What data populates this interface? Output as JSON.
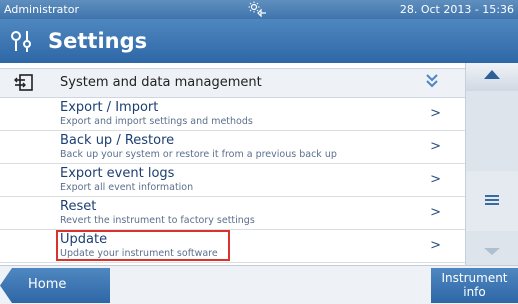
{
  "status": {
    "user": "Administrator",
    "datetime": "28. Oct 2013 - 15:36",
    "mode_icon": "sun-wave-icon"
  },
  "header": {
    "title": "Settings",
    "icon": "settings-sliders-icon"
  },
  "section": {
    "label": "System and data management",
    "icon": "system-data-icon",
    "collapse_icon": "double-chevron-down-icon"
  },
  "items": [
    {
      "name": "Export / Import",
      "desc": "Export and import settings and methods",
      "arrow": ">"
    },
    {
      "name": "Back up / Restore",
      "desc": "Back up your system or restore it from a previous back up",
      "arrow": ">"
    },
    {
      "name": "Export event logs",
      "desc": "Export all event information",
      "arrow": ">"
    },
    {
      "name": "Reset",
      "desc": "Revert the instrument to factory settings",
      "arrow": ">"
    },
    {
      "name": "Update",
      "desc": "Update your instrument software",
      "arrow": ">"
    }
  ],
  "footer": {
    "home_label": "Home",
    "info_label": "Instrument info"
  },
  "colors": {
    "brand_blue": "#2e67a6",
    "highlight_red": "#d9342b"
  }
}
